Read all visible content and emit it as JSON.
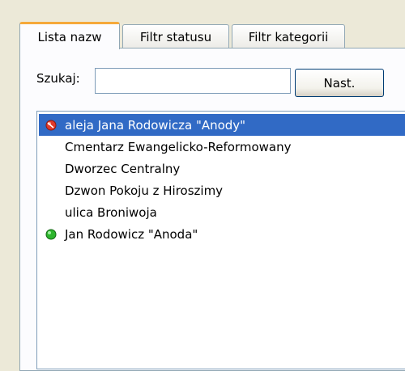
{
  "tabs": [
    {
      "label": "Lista nazw",
      "active": true
    },
    {
      "label": "Filtr statusu",
      "active": false
    },
    {
      "label": "Filtr kategorii",
      "active": false
    }
  ],
  "search": {
    "label": "Szukaj:",
    "value": "",
    "next_label": "Nast."
  },
  "list": {
    "items": [
      {
        "label": "aleja Jana Rodowicza \"Anody\"",
        "icon": "red-status-icon",
        "selected": true
      },
      {
        "label": "Cmentarz Ewangelicko-Reformowany",
        "icon": null,
        "selected": false
      },
      {
        "label": "Dworzec Centralny",
        "icon": null,
        "selected": false
      },
      {
        "label": "Dzwon Pokoju z Hiroszimy",
        "icon": null,
        "selected": false
      },
      {
        "label": "ulica Broniwoja",
        "icon": null,
        "selected": false
      },
      {
        "label": "Jan Rodowicz \"Anoda\"",
        "icon": "green-status-icon",
        "selected": false
      }
    ]
  },
  "colors": {
    "selection": "#316ac5",
    "active_tab_accent": "#f5a93a",
    "status_red": "#e03a2c",
    "status_green": "#2db52d"
  }
}
